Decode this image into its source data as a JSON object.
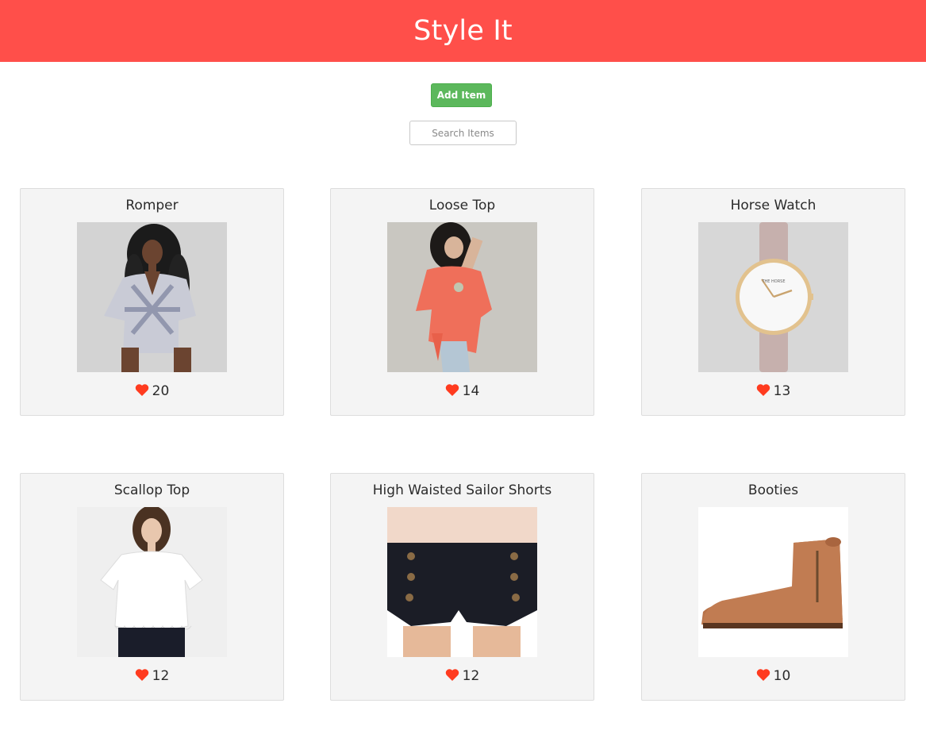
{
  "header": {
    "title": "Style It"
  },
  "toolbar": {
    "add_label": "Add Item"
  },
  "search": {
    "placeholder": "Search Items",
    "value": ""
  },
  "colors": {
    "brand": "#ff4f4a",
    "add_button": "#5cb85c",
    "heart": "#ff3b1f",
    "card_bg": "#f4f4f4"
  },
  "items": [
    {
      "title": "Romper",
      "likes": "20",
      "icon": "heart-icon"
    },
    {
      "title": "Loose Top",
      "likes": "14",
      "icon": "heart-icon"
    },
    {
      "title": "Horse Watch",
      "likes": "13",
      "icon": "heart-icon"
    },
    {
      "title": "Scallop Top",
      "likes": "12",
      "icon": "heart-icon"
    },
    {
      "title": "High Waisted Sailor Shorts",
      "likes": "12",
      "icon": "heart-icon"
    },
    {
      "title": "Booties",
      "likes": "10",
      "icon": "heart-icon"
    }
  ]
}
